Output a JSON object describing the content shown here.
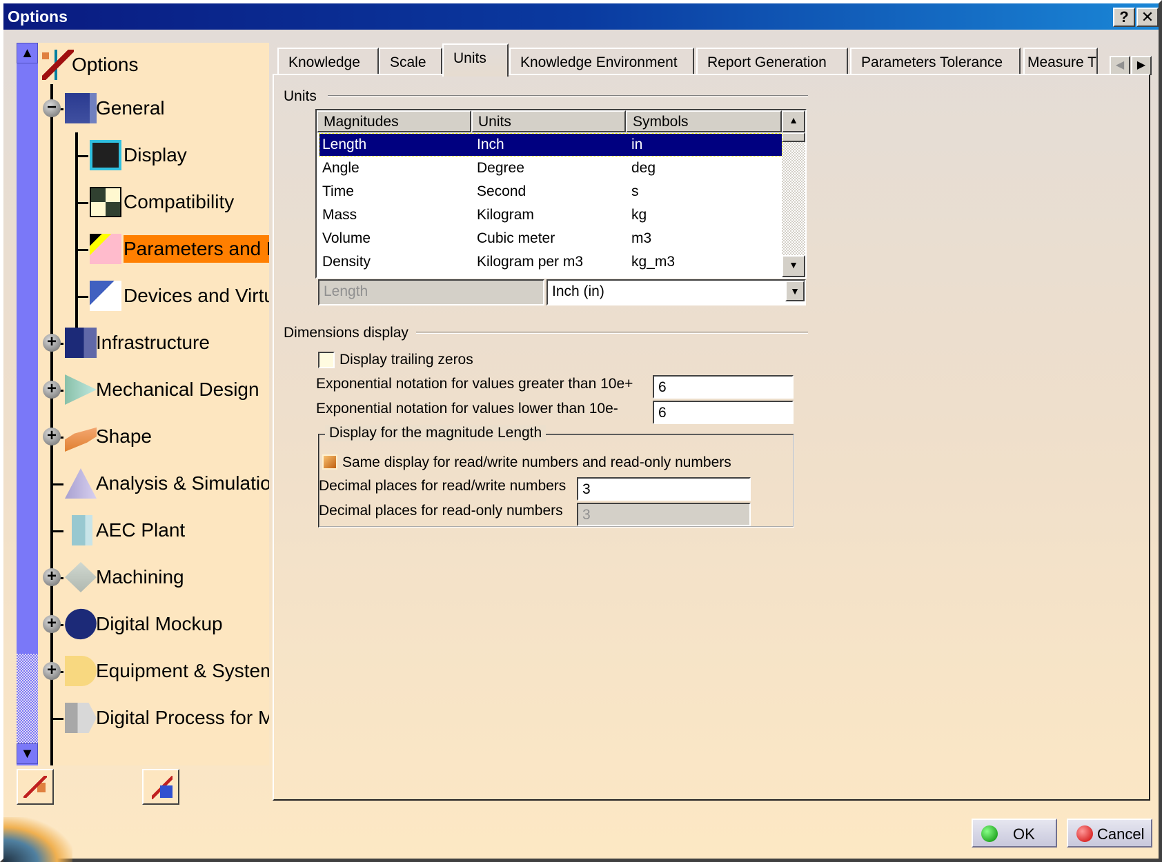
{
  "window": {
    "title": "Options",
    "help_label": "?",
    "close_label": "✕"
  },
  "tree": {
    "root": {
      "label": "Options",
      "icon": "options-tools-icon"
    },
    "items": [
      {
        "label": "General",
        "icon": "general-icon",
        "expander": "−",
        "level": 1
      },
      {
        "label": "Display",
        "icon": "display-icon",
        "level": 2
      },
      {
        "label": "Compatibility",
        "icon": "compatibility-icon",
        "level": 2
      },
      {
        "label": "Parameters and M",
        "icon": "parameters-icon",
        "level": 2,
        "selected": true
      },
      {
        "label": "Devices and Virtu",
        "icon": "devices-icon",
        "level": 2
      },
      {
        "label": "Infrastructure",
        "icon": "infrastructure-icon",
        "expander": "+",
        "level": 1
      },
      {
        "label": "Mechanical Design",
        "icon": "mechanical-design-icon",
        "expander": "+",
        "level": 1
      },
      {
        "label": "Shape",
        "icon": "shape-icon",
        "expander": "+",
        "level": 1
      },
      {
        "label": "Analysis & Simulation",
        "icon": "analysis-icon",
        "level": 1
      },
      {
        "label": "AEC Plant",
        "icon": "aec-plant-icon",
        "level": 1
      },
      {
        "label": "Machining",
        "icon": "machining-icon",
        "expander": "+",
        "level": 1
      },
      {
        "label": "Digital Mockup",
        "icon": "digital-mockup-icon",
        "expander": "+",
        "level": 1
      },
      {
        "label": "Equipment & Systems",
        "icon": "equipment-icon",
        "expander": "+",
        "level": 1
      },
      {
        "label": "Digital Process for M",
        "icon": "digital-process-icon",
        "level": 1
      }
    ],
    "selected_color": "#ff7f00"
  },
  "tabs": [
    {
      "label": "Knowledge"
    },
    {
      "label": "Scale"
    },
    {
      "label": "Units",
      "selected": true
    },
    {
      "label": "Knowledge Environment"
    },
    {
      "label": "Report Generation"
    },
    {
      "label": "Parameters Tolerance"
    },
    {
      "label": "Measure T"
    }
  ],
  "units": {
    "group_label": "Units",
    "columns": [
      "Magnitudes",
      "Units",
      "Symbols"
    ],
    "rows": [
      [
        "Length",
        "Inch",
        "in"
      ],
      [
        "Angle",
        "Degree",
        "deg"
      ],
      [
        "Time",
        "Second",
        "s"
      ],
      [
        "Mass",
        "Kilogram",
        "kg"
      ],
      [
        "Volume",
        "Cubic meter",
        "m3"
      ],
      [
        "Density",
        "Kilogram per m3",
        "kg_m3"
      ]
    ],
    "selected_magnitude": "Length",
    "selected_unit": "Inch (in)"
  },
  "dimensions": {
    "group_label": "Dimensions display",
    "trailing_zeros_label": "Display trailing zeros",
    "trailing_zeros_checked": false,
    "exp_greater_label": "Exponential notation for values greater than 10e+",
    "exp_greater_value": "6",
    "exp_lower_label": "Exponential notation for values lower than 10e-",
    "exp_lower_value": "6",
    "length_group_label": "Display for the magnitude Length",
    "same_display_label": "Same display for read/write numbers and read-only numbers",
    "same_display_checked": true,
    "rw_label": "Decimal places for read/write numbers",
    "rw_value": "3",
    "ro_label": "Decimal places for read-only numbers",
    "ro_value": "3"
  },
  "buttons": {
    "ok": "OK",
    "cancel": "Cancel"
  }
}
